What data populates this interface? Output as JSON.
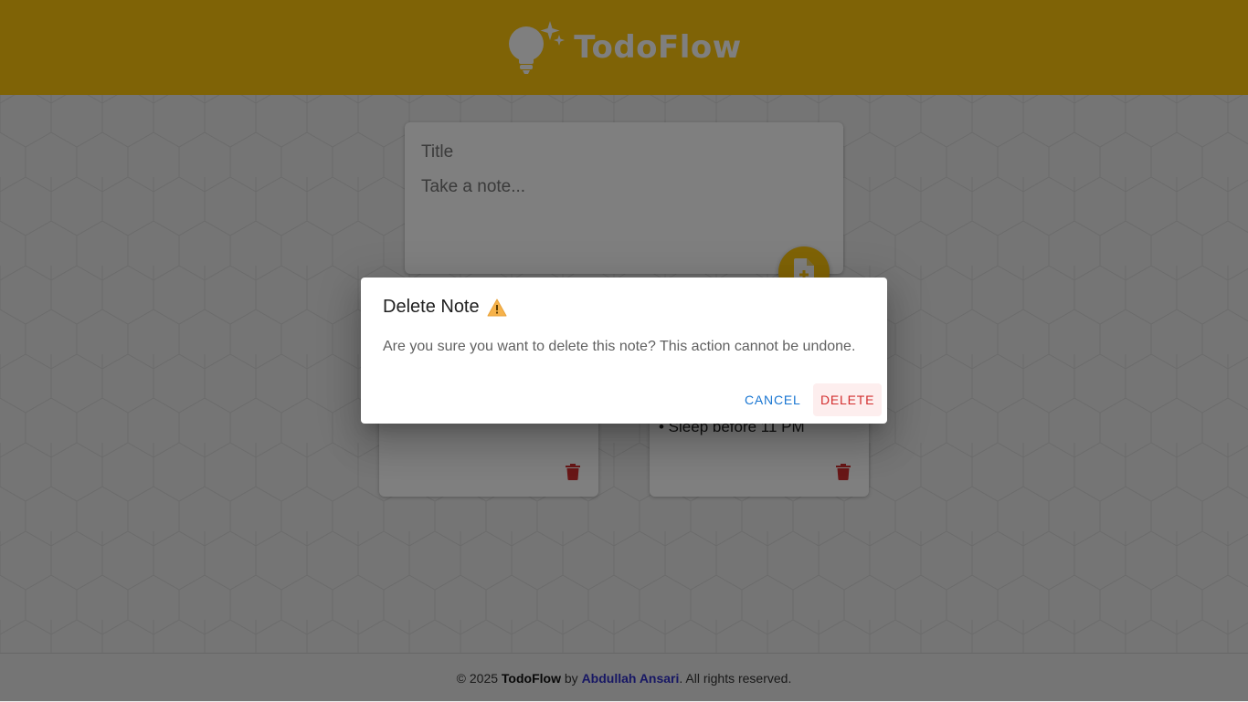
{
  "app": {
    "name": "TodoFlow"
  },
  "colors": {
    "brand": "#fec60d",
    "danger": "#d32f2f",
    "primary": "#1976d2",
    "link": "#2f2fc8"
  },
  "composer": {
    "title_placeholder": "Title",
    "body_placeholder": "Take a note..."
  },
  "notes": [
    {
      "lines": []
    },
    {
      "lines": [
        "• Sleep before 11 PM"
      ]
    }
  ],
  "dialog": {
    "title": "Delete Note",
    "title_icon": "warning-icon",
    "message": "Are you sure you want to delete this note? This action cannot be undone.",
    "cancel_label": "CANCEL",
    "delete_label": "DELETE"
  },
  "footer": {
    "copyright": "© 2025",
    "brand": "TodoFlow",
    "by": "by",
    "author": "Abdullah Ansari",
    "rights": ". All rights reserved."
  }
}
